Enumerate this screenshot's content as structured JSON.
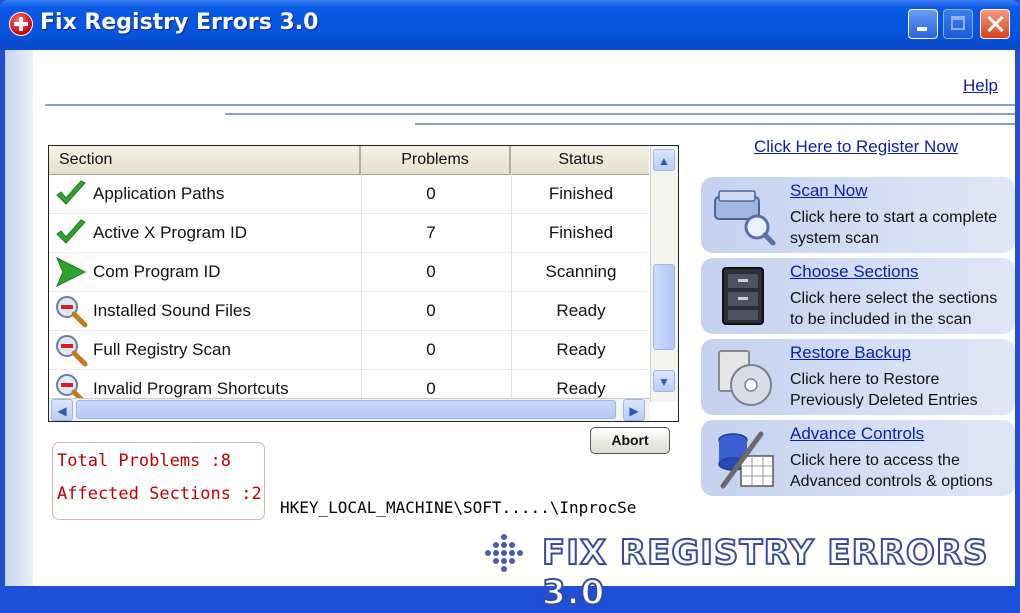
{
  "window": {
    "title": "Fix Registry Errors 3.0"
  },
  "header": {
    "help_label": "Help"
  },
  "table": {
    "columns": [
      "Section",
      "Problems",
      "Status"
    ],
    "rows": [
      {
        "section": "Application Paths",
        "problems": "0",
        "status": "Finished",
        "icon": "green-check-icon"
      },
      {
        "section": "Active X Program ID",
        "problems": "7",
        "status": "Finished",
        "icon": "green-check-icon"
      },
      {
        "section": "Com Program ID",
        "problems": "0",
        "status": "Scanning",
        "icon": "green-arrow-icon"
      },
      {
        "section": "Installed Sound Files",
        "problems": "0",
        "status": "Ready",
        "icon": "magnifier-icon"
      },
      {
        "section": "Full Registry Scan",
        "problems": "0",
        "status": "Ready",
        "icon": "magnifier-icon"
      },
      {
        "section": "Invalid Program Shortcuts",
        "problems": "0",
        "status": "Ready",
        "icon": "magnifier-icon"
      }
    ]
  },
  "summary": {
    "total_problems": "Total Problems :8",
    "affected_sections": "Affected Sections :2"
  },
  "abort_label": "Abort",
  "registry_path": "HKEY_LOCAL_MACHINE\\SOFT.....\\InprocSe",
  "register_link": "Click Here to Register Now",
  "actions": [
    {
      "label": "Scan Now",
      "desc": "Click here to start a complete system scan",
      "icon": "scanner-icon"
    },
    {
      "label": "Choose Sections",
      "desc": "Click here select the sections to be included in the scan",
      "icon": "file-cabinet-icon"
    },
    {
      "label": "Restore Backup",
      "desc": "Click here to Restore Previously Deleted Entries",
      "icon": "backup-disc-icon"
    },
    {
      "label": "Advance Controls",
      "desc": "Click here to access the Advanced controls & options",
      "icon": "tools-icon"
    }
  ],
  "logo_text": "FIX REGISTRY ERRORS 3.0",
  "colors": {
    "titlebar": "#0654e0",
    "link": "#0a1ea8",
    "alert": "#c00000",
    "card": "#c5d1ef"
  }
}
